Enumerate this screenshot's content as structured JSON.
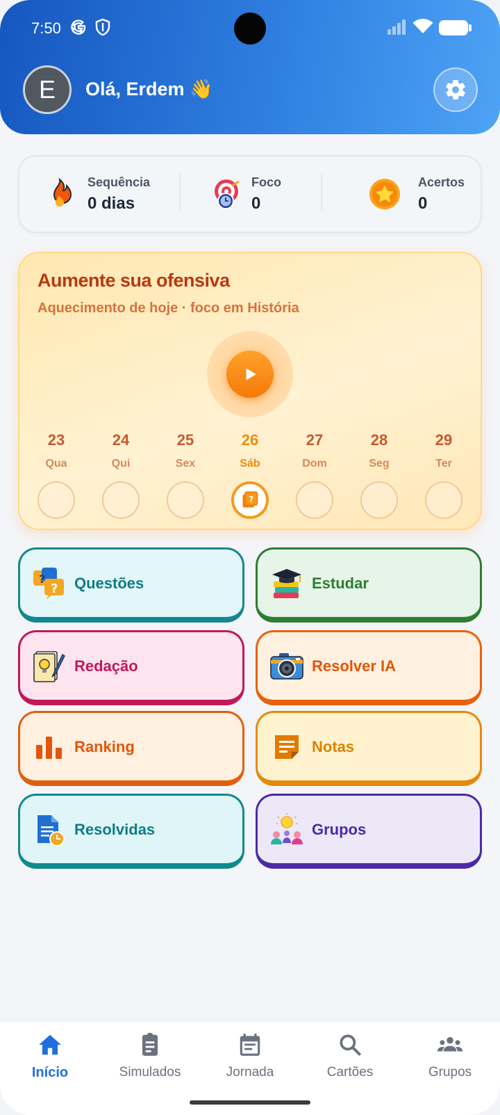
{
  "status_bar": {
    "time": "7:50"
  },
  "header": {
    "avatar_letter": "E",
    "greeting": "Olá, Erdem 👋"
  },
  "stats": [
    {
      "label": "Sequência",
      "value": "0 dias",
      "icon": "fire-icon"
    },
    {
      "label": "Foco",
      "value": "0",
      "icon": "target-clock-icon"
    },
    {
      "label": "Acertos",
      "value": "0",
      "icon": "star-icon"
    }
  ],
  "streak_card": {
    "title": "Aumente sua ofensiva",
    "subtitle": "Aquecimento de hoje · foco em História",
    "days": [
      {
        "num": "23",
        "weekday": "Qua",
        "active": false
      },
      {
        "num": "24",
        "weekday": "Qui",
        "active": false
      },
      {
        "num": "25",
        "weekday": "Sex",
        "active": false
      },
      {
        "num": "26",
        "weekday": "Sáb",
        "active": true
      },
      {
        "num": "27",
        "weekday": "Dom",
        "active": false
      },
      {
        "num": "28",
        "weekday": "Seg",
        "active": false
      },
      {
        "num": "29",
        "weekday": "Ter",
        "active": false
      }
    ]
  },
  "tiles": [
    {
      "label": "Questões",
      "icon": "question-bubbles-icon",
      "bg": "#e3f6fa",
      "border": "#13878f",
      "color": "#0f7c86"
    },
    {
      "label": "Estudar",
      "icon": "graduation-books-icon",
      "bg": "#e6f5e8",
      "border": "#2e7d32",
      "color": "#2e7d32"
    },
    {
      "label": "Redação",
      "icon": "essay-pencil-icon",
      "bg": "#fde4ee",
      "border": "#c2185b",
      "color": "#c2185b"
    },
    {
      "label": "Resolver IA",
      "icon": "camera-icon",
      "bg": "#fff0e0",
      "border": "#e8620c",
      "color": "#e0560a"
    },
    {
      "label": "Ranking",
      "icon": "bar-chart-icon",
      "bg": "#fff0e0",
      "border": "#e0600e",
      "color": "#e0560a"
    },
    {
      "label": "Notas",
      "icon": "note-icon",
      "bg": "#fff3cf",
      "border": "#e48a0c",
      "color": "#d98200"
    },
    {
      "label": "Resolvidas",
      "icon": "document-clock-icon",
      "bg": "#e0f5f7",
      "border": "#0f8a8c",
      "color": "#0f7c86"
    },
    {
      "label": "Grupos",
      "icon": "group-idea-icon",
      "bg": "#ece8f7",
      "border": "#4b2aa6",
      "color": "#4b2aa6"
    }
  ],
  "bottom_nav": [
    {
      "label": "Início",
      "icon": "home-icon",
      "active": true
    },
    {
      "label": "Simulados",
      "icon": "clipboard-icon",
      "active": false
    },
    {
      "label": "Jornada",
      "icon": "calendar-icon",
      "active": false
    },
    {
      "label": "Cartões",
      "icon": "search-icon",
      "active": false
    },
    {
      "label": "Grupos",
      "icon": "people-icon",
      "active": false
    }
  ]
}
